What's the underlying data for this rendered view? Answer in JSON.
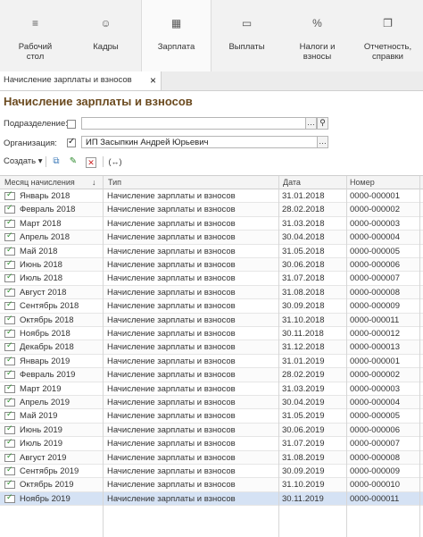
{
  "nav": [
    {
      "icon": "≡",
      "label": "Рабочий\nстол"
    },
    {
      "icon": "☺",
      "label": "Кадры"
    },
    {
      "icon": "▦",
      "label": "Зарплата"
    },
    {
      "icon": "▭",
      "label": "Выплаты"
    },
    {
      "icon": "%",
      "label": "Налоги и\nвзносы"
    },
    {
      "icon": "❐",
      "label": "Отчетность,\nсправки"
    }
  ],
  "tab": {
    "label": "Начисление зарплаты и взносов",
    "close": "×"
  },
  "title": "Начисление зарплаты и взносов",
  "filters": {
    "subdivision_label": "Подразделение:",
    "subdivision_value": "",
    "organization_label": "Организация:",
    "organization_value": "ИП Засыпкин Андрей Юрьевич"
  },
  "toolbar": {
    "create_label": "Создать",
    "create_arrow": "▾"
  },
  "table": {
    "columns": [
      "Месяц начисления",
      "Тип",
      "Дата",
      "Номер"
    ],
    "sort_indicator": "↓",
    "rows": [
      [
        "Январь 2018",
        "Начисление зарплаты и взносов",
        "31.01.2018",
        "0000-000001"
      ],
      [
        "Февраль 2018",
        "Начисление зарплаты и взносов",
        "28.02.2018",
        "0000-000002"
      ],
      [
        "Март 2018",
        "Начисление зарплаты и взносов",
        "31.03.2018",
        "0000-000003"
      ],
      [
        "Апрель 2018",
        "Начисление зарплаты и взносов",
        "30.04.2018",
        "0000-000004"
      ],
      [
        "Май 2018",
        "Начисление зарплаты и взносов",
        "31.05.2018",
        "0000-000005"
      ],
      [
        "Июнь 2018",
        "Начисление зарплаты и взносов",
        "30.06.2018",
        "0000-000006"
      ],
      [
        "Июль 2018",
        "Начисление зарплаты и взносов",
        "31.07.2018",
        "0000-000007"
      ],
      [
        "Август 2018",
        "Начисление зарплаты и взносов",
        "31.08.2018",
        "0000-000008"
      ],
      [
        "Сентябрь 2018",
        "Начисление зарплаты и взносов",
        "30.09.2018",
        "0000-000009"
      ],
      [
        "Октябрь 2018",
        "Начисление зарплаты и взносов",
        "31.10.2018",
        "0000-000011"
      ],
      [
        "Ноябрь 2018",
        "Начисление зарплаты и взносов",
        "30.11.2018",
        "0000-000012"
      ],
      [
        "Декабрь 2018",
        "Начисление зарплаты и взносов",
        "31.12.2018",
        "0000-000013"
      ],
      [
        "Январь 2019",
        "Начисление зарплаты и взносов",
        "31.01.2019",
        "0000-000001"
      ],
      [
        "Февраль 2019",
        "Начисление зарплаты и взносов",
        "28.02.2019",
        "0000-000002"
      ],
      [
        "Март 2019",
        "Начисление зарплаты и взносов",
        "31.03.2019",
        "0000-000003"
      ],
      [
        "Апрель 2019",
        "Начисление зарплаты и взносов",
        "30.04.2019",
        "0000-000004"
      ],
      [
        "Май 2019",
        "Начисление зарплаты и взносов",
        "31.05.2019",
        "0000-000005"
      ],
      [
        "Июнь 2019",
        "Начисление зарплаты и взносов",
        "30.06.2019",
        "0000-000006"
      ],
      [
        "Июль 2019",
        "Начисление зарплаты и взносов",
        "31.07.2019",
        "0000-000007"
      ],
      [
        "Август 2019",
        "Начисление зарплаты и взносов",
        "31.08.2019",
        "0000-000008"
      ],
      [
        "Сентябрь 2019",
        "Начисление зарплаты и взносов",
        "30.09.2019",
        "0000-000009"
      ],
      [
        "Октябрь 2019",
        "Начисление зарплаты и взносов",
        "31.10.2019",
        "0000-000010"
      ],
      [
        "Ноябрь 2019",
        "Начисление зарплаты и взносов",
        "30.11.2019",
        "0000-000011"
      ]
    ],
    "selected_index": 22
  },
  "colors": {
    "title": "#6b4a1f",
    "selected_row": "#d5e2f4"
  }
}
